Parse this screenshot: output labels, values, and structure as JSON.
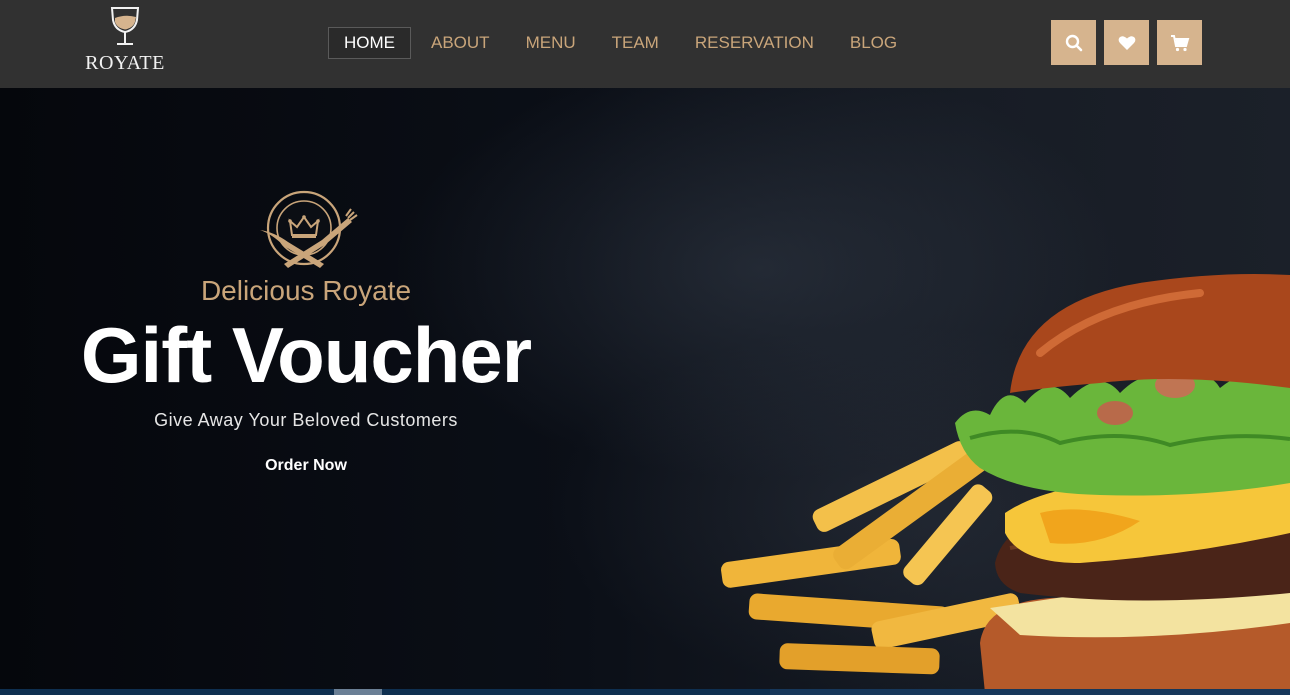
{
  "brand": {
    "name": "ROYATE",
    "accent_color": "#c9a57a",
    "button_color": "#d6b48e"
  },
  "nav": {
    "items": [
      {
        "label": "HOME",
        "active": true
      },
      {
        "label": "ABOUT",
        "active": false
      },
      {
        "label": "MENU",
        "active": false
      },
      {
        "label": "TEAM",
        "active": false
      },
      {
        "label": "RESERVATION",
        "active": false
      },
      {
        "label": "BLOG",
        "active": false
      }
    ]
  },
  "header_icons": [
    "search-icon",
    "heart-icon",
    "cart-icon"
  ],
  "hero": {
    "kicker": "Delicious Royate",
    "title": "Gift Voucher",
    "subtitle": "Give Away Your Beloved Customers",
    "cta_label": "Order Now"
  }
}
